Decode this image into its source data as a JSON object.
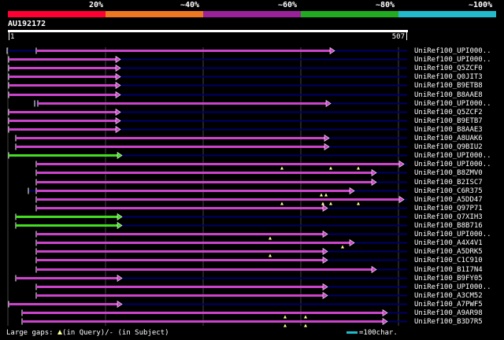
{
  "scale": {
    "labels": [
      "20%",
      "~40%",
      "~60%",
      "~80%",
      "~100%"
    ],
    "colors": [
      "#ff0033",
      "#ee7722",
      "#992299",
      "#22aa22",
      "#22bbcc"
    ]
  },
  "query": {
    "id": "AU192172",
    "start": "1",
    "end": "507",
    "length": 507
  },
  "colors": {
    "background": "#000000",
    "purple_bar": "#cc44cc",
    "green_bar": "#44dd22",
    "gap_line": "#000066",
    "grid": "#444444",
    "gap_marker": "#ffff99"
  },
  "hits": [
    {
      "name": "UniRef100_UPI000..",
      "color": "purple",
      "bar_start": 46,
      "bar_end": 425,
      "frag_start": 9,
      "markers": []
    },
    {
      "name": "UniRef100_UPI000..",
      "color": "purple",
      "bar_start": 11,
      "bar_end": 153,
      "frag_start": 11,
      "markers": []
    },
    {
      "name": "UniRef100_Q5ZCF0",
      "color": "purple",
      "bar_start": 11,
      "bar_end": 153,
      "frag_start": 11,
      "markers": []
    },
    {
      "name": "UniRef100_Q0JIT3",
      "color": "purple",
      "bar_start": 11,
      "bar_end": 153,
      "frag_start": 11,
      "markers": []
    },
    {
      "name": "UniRef100_B9ETB8",
      "color": "purple",
      "bar_start": 11,
      "bar_end": 153,
      "frag_start": 11,
      "markers": []
    },
    {
      "name": "UniRef100_B8AAE8",
      "color": "purple",
      "bar_start": 11,
      "bar_end": 153,
      "frag_start": 11,
      "markers": []
    },
    {
      "name": "UniRef100_UPI000..",
      "color": "purple",
      "bar_start": 48,
      "bar_end": 420,
      "frag_start": 44,
      "markers": []
    },
    {
      "name": "UniRef100_Q5ZCF2",
      "color": "purple",
      "bar_start": 11,
      "bar_end": 153,
      "frag_start": 11,
      "markers": []
    },
    {
      "name": "UniRef100_B9ETB7",
      "color": "purple",
      "bar_start": 11,
      "bar_end": 153,
      "frag_start": 11,
      "markers": []
    },
    {
      "name": "UniRef100_B8AAE3",
      "color": "purple",
      "bar_start": 11,
      "bar_end": 153,
      "frag_start": 11,
      "markers": []
    },
    {
      "name": "UniRef100_A8UAK6",
      "color": "purple",
      "bar_start": 20,
      "bar_end": 418,
      "frag_start": 20,
      "markers": []
    },
    {
      "name": "UniRef100_Q9BIU2",
      "color": "purple",
      "bar_start": 20,
      "bar_end": 418,
      "frag_start": 20,
      "markers": []
    },
    {
      "name": "UniRef100_UPI000..",
      "color": "green",
      "bar_start": 11,
      "bar_end": 155,
      "frag_start": 11,
      "markers": []
    },
    {
      "name": "UniRef100_UPI000..",
      "color": "purple",
      "bar_start": 46,
      "bar_end": 513,
      "frag_start": 46,
      "markers": [
        358,
        420,
        455
      ]
    },
    {
      "name": "UniRef100_B8ZMV0",
      "color": "purple",
      "bar_start": 46,
      "bar_end": 478,
      "frag_start": 46,
      "markers": []
    },
    {
      "name": "UniRef100_B2ISC7",
      "color": "purple",
      "bar_start": 46,
      "bar_end": 478,
      "frag_start": 46,
      "markers": []
    },
    {
      "name": "UniRef100_C6R375",
      "color": "purple",
      "bar_start": 46,
      "bar_end": 450,
      "frag_start": 36,
      "markers": [
        408,
        414
      ]
    },
    {
      "name": "UniRef100_A5DD47",
      "color": "purple",
      "bar_start": 46,
      "bar_end": 513,
      "frag_start": 46,
      "markers": [
        358,
        410,
        420,
        455
      ]
    },
    {
      "name": "UniRef100_Q97P71",
      "color": "purple",
      "bar_start": 46,
      "bar_end": 416,
      "frag_start": 46,
      "markers": []
    },
    {
      "name": "UniRef100_Q7XIH3",
      "color": "green",
      "bar_start": 20,
      "bar_end": 155,
      "frag_start": 20,
      "markers": []
    },
    {
      "name": "UniRef100_B8B716",
      "color": "green",
      "bar_start": 20,
      "bar_end": 155,
      "frag_start": 20,
      "markers": []
    },
    {
      "name": "UniRef100_UPI000..",
      "color": "purple",
      "bar_start": 46,
      "bar_end": 416,
      "frag_start": 46,
      "markers": [
        343
      ]
    },
    {
      "name": "UniRef100_A4X4V1",
      "color": "purple",
      "bar_start": 46,
      "bar_end": 450,
      "frag_start": 46,
      "markers": [
        435
      ]
    },
    {
      "name": "UniRef100_A5DRK5",
      "color": "purple",
      "bar_start": 46,
      "bar_end": 416,
      "frag_start": 46,
      "markers": [
        343
      ]
    },
    {
      "name": "UniRef100_C1C910",
      "color": "purple",
      "bar_start": 46,
      "bar_end": 416,
      "frag_start": 46,
      "markers": []
    },
    {
      "name": "UniRef100_B1I7N4",
      "color": "purple",
      "bar_start": 46,
      "bar_end": 478,
      "frag_start": 46,
      "markers": []
    },
    {
      "name": "UniRef100_B9FY05",
      "color": "purple",
      "bar_start": 20,
      "bar_end": 155,
      "frag_start": 20,
      "markers": []
    },
    {
      "name": "UniRef100_UPI000..",
      "color": "purple",
      "bar_start": 46,
      "bar_end": 416,
      "frag_start": 46,
      "markers": []
    },
    {
      "name": "UniRef100_A3CM52",
      "color": "purple",
      "bar_start": 46,
      "bar_end": 416,
      "frag_start": 46,
      "markers": []
    },
    {
      "name": "UniRef100_A7PWF5",
      "color": "purple",
      "bar_start": 11,
      "bar_end": 155,
      "frag_start": 11,
      "markers": []
    },
    {
      "name": "UniRef100_A9AR98",
      "color": "purple",
      "bar_start": 28,
      "bar_end": 492,
      "frag_start": 28,
      "markers": [
        362,
        388
      ]
    },
    {
      "name": "UniRef100_B3D7R5",
      "color": "purple",
      "bar_start": 28,
      "bar_end": 492,
      "frag_start": 28,
      "markers": [
        362,
        388
      ]
    }
  ],
  "legend": {
    "prefix": "Large gaps:",
    "query_label": "(in Query)",
    "separator": "/",
    "subject_label": "- (in Subject)",
    "scale_text": "=100char.",
    "scale_color": "#22bbcc"
  }
}
